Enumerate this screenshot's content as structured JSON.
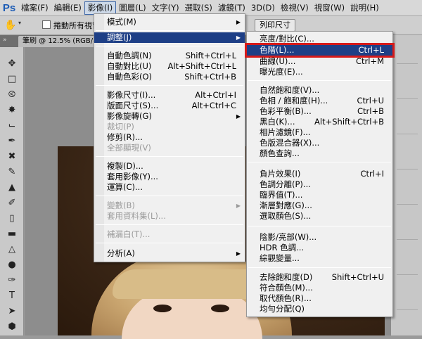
{
  "menubar": {
    "app_logo": "Ps",
    "items": [
      "檔案(F)",
      "編輯(E)",
      "影像(I)",
      "圖層(L)",
      "文字(Y)",
      "選取(S)",
      "濾鏡(T)",
      "3D(D)",
      "檢視(V)",
      "視窗(W)",
      "說明(H)"
    ]
  },
  "options_bar": {
    "tool_icon": "hand-icon",
    "scroll_all_windows_label": "捲動所有視窗",
    "print_size_button": "列印尺寸"
  },
  "document": {
    "tab_title": "筆刷 @ 12.5% (RGB/8)"
  },
  "image_menu": {
    "items": [
      {
        "label": "模式(M)",
        "shortcut": "",
        "submenu": true,
        "disabled": false
      },
      {
        "label": "調整(J)",
        "shortcut": "",
        "submenu": true,
        "disabled": false,
        "highlighted": true
      },
      {
        "label": "自動色調(N)",
        "shortcut": "Shift+Ctrl+L",
        "disabled": false
      },
      {
        "label": "自動對比(U)",
        "shortcut": "Alt+Shift+Ctrl+L",
        "disabled": false
      },
      {
        "label": "自動色彩(O)",
        "shortcut": "Shift+Ctrl+B",
        "disabled": false
      },
      {
        "label": "影像尺寸(I)...",
        "shortcut": "Alt+Ctrl+I",
        "disabled": false
      },
      {
        "label": "版面尺寸(S)...",
        "shortcut": "Alt+Ctrl+C",
        "disabled": false
      },
      {
        "label": "影像旋轉(G)",
        "shortcut": "",
        "submenu": true,
        "disabled": false
      },
      {
        "label": "裁切(P)",
        "shortcut": "",
        "disabled": true
      },
      {
        "label": "修剪(R)...",
        "shortcut": "",
        "disabled": false
      },
      {
        "label": "全部顯現(V)",
        "shortcut": "",
        "disabled": true
      },
      {
        "label": "複製(D)...",
        "shortcut": "",
        "disabled": false
      },
      {
        "label": "套用影像(Y)...",
        "shortcut": "",
        "disabled": false
      },
      {
        "label": "運算(C)...",
        "shortcut": "",
        "disabled": false
      },
      {
        "label": "變數(B)",
        "shortcut": "",
        "submenu": true,
        "disabled": true
      },
      {
        "label": "套用資料集(L)...",
        "shortcut": "",
        "disabled": true
      },
      {
        "label": "補漏白(T)...",
        "shortcut": "",
        "disabled": true
      },
      {
        "label": "分析(A)",
        "shortcut": "",
        "submenu": true,
        "disabled": false
      }
    ]
  },
  "adjust_menu": {
    "items": [
      {
        "label": "亮度/對比(C)...",
        "shortcut": ""
      },
      {
        "label": "色階(L)...",
        "shortcut": "Ctrl+L",
        "highlighted": true
      },
      {
        "label": "曲線(U)...",
        "shortcut": "Ctrl+M"
      },
      {
        "label": "曝光度(E)...",
        "shortcut": ""
      },
      {
        "label": "自然飽和度(V)...",
        "shortcut": ""
      },
      {
        "label": "色相 / 飽和度(H)...",
        "shortcut": "Ctrl+U"
      },
      {
        "label": "色彩平衡(B)...",
        "shortcut": "Ctrl+B"
      },
      {
        "label": "黑白(K)...",
        "shortcut": "Alt+Shift+Ctrl+B"
      },
      {
        "label": "相片濾鏡(F)...",
        "shortcut": ""
      },
      {
        "label": "色版混合器(X)...",
        "shortcut": ""
      },
      {
        "label": "顏色查詢...",
        "shortcut": ""
      },
      {
        "label": "負片效果(I)",
        "shortcut": "Ctrl+I"
      },
      {
        "label": "色調分離(P)...",
        "shortcut": ""
      },
      {
        "label": "臨界值(T)...",
        "shortcut": ""
      },
      {
        "label": "漸層對應(G)...",
        "shortcut": ""
      },
      {
        "label": "選取顏色(S)...",
        "shortcut": ""
      },
      {
        "label": "陰影/亮部(W)...",
        "shortcut": ""
      },
      {
        "label": "HDR 色調...",
        "shortcut": ""
      },
      {
        "label": "綜觀變量...",
        "shortcut": ""
      },
      {
        "label": "去除飽和度(D)",
        "shortcut": "Shift+Ctrl+U"
      },
      {
        "label": "符合顏色(M)...",
        "shortcut": ""
      },
      {
        "label": "取代顏色(R)...",
        "shortcut": ""
      },
      {
        "label": "均勻分配(Q)",
        "shortcut": ""
      }
    ]
  },
  "colors": {
    "menu_highlight": "#1e3f86",
    "annotation_box": "#d61a1a",
    "ps_logo": "#1b5bb5"
  }
}
